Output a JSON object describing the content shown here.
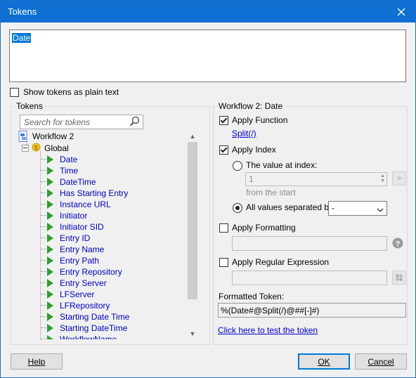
{
  "window": {
    "title": "Tokens"
  },
  "editor": {
    "text": "Date"
  },
  "show_plain": {
    "label": "Show tokens as plain text",
    "checked": false
  },
  "tokens_panel": {
    "legend": "Tokens",
    "search_placeholder": "Search for tokens",
    "root": "Workflow 2",
    "global": "Global",
    "items": [
      "Date",
      "Time",
      "DateTime",
      "Has Starting Entry",
      "Instance URL",
      "Initiator",
      "Initiator SID",
      "Entry ID",
      "Entry Name",
      "Entry Path",
      "Entry Repository",
      "Entry Server",
      "LFServer",
      "LFRepository",
      "Starting Date Time",
      "Starting DateTime",
      "WorkflowName"
    ]
  },
  "right": {
    "legend": "Workflow 2: Date",
    "apply_function": {
      "label": "Apply Function",
      "checked": true,
      "link": "Split(/)"
    },
    "apply_index": {
      "label": "Apply Index",
      "checked": true
    },
    "value_at_index": {
      "label": "The value at index:",
      "selected": false,
      "value": "1",
      "go": ">"
    },
    "from_start": "from the  start",
    "all_values": {
      "label": "All values separated by:",
      "selected": true,
      "value": "-"
    },
    "apply_formatting": {
      "label": "Apply Formatting",
      "checked": false
    },
    "apply_regex": {
      "label": "Apply Regular Expression",
      "checked": false
    },
    "formatted_label": "Formatted Token:",
    "formatted_value": "%(Date#@Split(/)@##[-]#)",
    "test_link": "Click here to test the token"
  },
  "buttons": {
    "help": "Help",
    "ok": "OK",
    "cancel": "Cancel"
  },
  "colors": {
    "titlebar": "#0f6fd3",
    "link": "#0000cc",
    "selection": "#0078d7"
  }
}
